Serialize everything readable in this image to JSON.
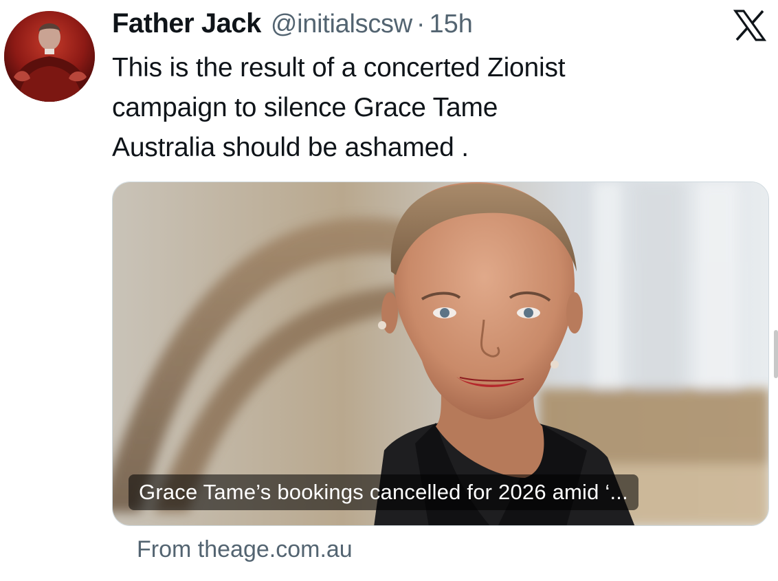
{
  "tweet": {
    "author": {
      "display_name": "Father Jack",
      "handle": "@initialscsw",
      "separator": "·",
      "timestamp": "15h",
      "avatar_icon": "avatar-image"
    },
    "text_lines": [
      "This is the result of a concerted Zionist",
      "campaign to silence Grace Tame",
      "Australia should be ashamed ."
    ],
    "platform_icon": "x-logo-icon",
    "card": {
      "title": "Grace Tame’s bookings cancelled for 2026 amid ‘...",
      "source": "From theage.com.au"
    }
  },
  "colors": {
    "text_primary": "#0f1419",
    "text_secondary": "#536471",
    "card_border": "#cfd9de",
    "background": "#ffffff"
  }
}
